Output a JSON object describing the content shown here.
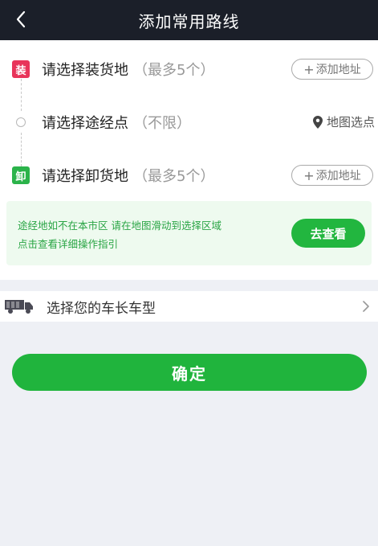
{
  "header": {
    "title": "添加常用路线"
  },
  "route": {
    "load": {
      "badge": "装",
      "label": "请选择装货地",
      "hint": "（最多5个）",
      "add_label": "添加地址"
    },
    "via": {
      "label": "请选择途经点",
      "hint": "（不限）",
      "map_pick_label": "地图选点"
    },
    "unload": {
      "badge": "卸",
      "label": "请选择卸货地",
      "hint": "（最多5个）",
      "add_label": "添加地址"
    }
  },
  "notice": {
    "line1": "途经地如不在本市区 请在地图滑动到选择区域",
    "line2": "点击查看详细操作指引",
    "button_label": "去查看"
  },
  "vehicle": {
    "label": "选择您的车长车型"
  },
  "confirm": {
    "label": "确定"
  },
  "colors": {
    "header_bg": "#1b1f29",
    "load_badge": "#e8345a",
    "unload_badge": "#2bb34a",
    "primary_green": "#20b43d",
    "notice_bg": "#eefaef"
  },
  "icons": {
    "back": "chevron-left-icon",
    "via": "circle-dot-icon",
    "map_pick": "location-pin-icon",
    "vehicle": "truck-icon",
    "vehicle_more": "chevron-right-icon"
  }
}
